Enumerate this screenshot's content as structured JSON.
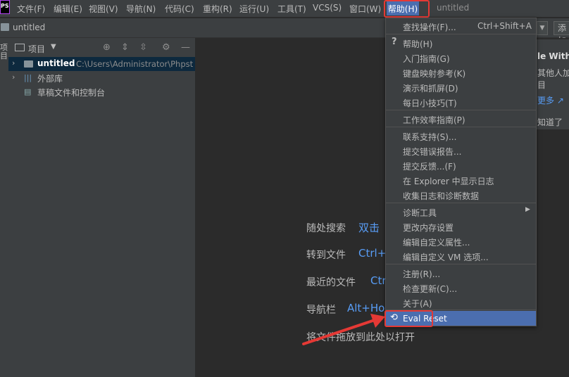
{
  "menubar": {
    "logo_text": "PS",
    "items": [
      "文件(F)",
      "编辑(E)",
      "视图(V)",
      "导航(N)",
      "代码(C)",
      "重构(R)",
      "运行(U)",
      "工具(T)",
      "VCS(S)",
      "窗口(W)"
    ],
    "active_item": "帮助(H)",
    "window_title": "untitled"
  },
  "navbar": {
    "project": "untitled",
    "add_button": "添加"
  },
  "toolstrip": {
    "label": "项目"
  },
  "project_panel": {
    "title": "项目",
    "tree": [
      {
        "label": "untitled",
        "path": "C:\\Users\\Administrator\\Phpst"
      },
      {
        "label": "外部库"
      },
      {
        "label": "草稿文件和控制台"
      }
    ]
  },
  "editor_hints": [
    {
      "label": "随处搜索",
      "key": "双击"
    },
    {
      "label": "转到文件",
      "key": "Ctrl+"
    },
    {
      "label": "最近的文件",
      "key": "Ctr"
    },
    {
      "label": "导航栏",
      "key": "Alt+Ho"
    },
    {
      "label": "将文件拖放到此处以打开",
      "key": ""
    }
  ],
  "popup": {
    "title": "le With",
    "line1": "其他人加",
    "line2": "目",
    "link": "更多 ↗",
    "dismiss": "知道了"
  },
  "help_menu": {
    "find_action": "查找操作(F)...",
    "find_action_shortcut": "Ctrl+Shift+A",
    "group1": [
      "帮助(H)",
      "入门指南(G)",
      "键盘映射参考(K)",
      "演示和抓屏(D)",
      "每日小技巧(T)"
    ],
    "group2": [
      "工作效率指南(P)"
    ],
    "group3": [
      "联系支持(S)...",
      "提交错误报告...",
      "提交反馈...(F)",
      "在 Explorer 中显示日志",
      "收集日志和诊断数据"
    ],
    "group4": [
      "诊断工具",
      "更改内存设置",
      "编辑自定义属性...",
      "编辑自定义 VM 选项..."
    ],
    "group5": [
      "注册(R)...",
      "检查更新(C)...",
      "关于(A)"
    ],
    "eval_reset": "Eval Reset"
  },
  "colors": {
    "highlight_red": "#e53935",
    "selection_blue": "#4b6eaf",
    "link_blue": "#589df6"
  }
}
